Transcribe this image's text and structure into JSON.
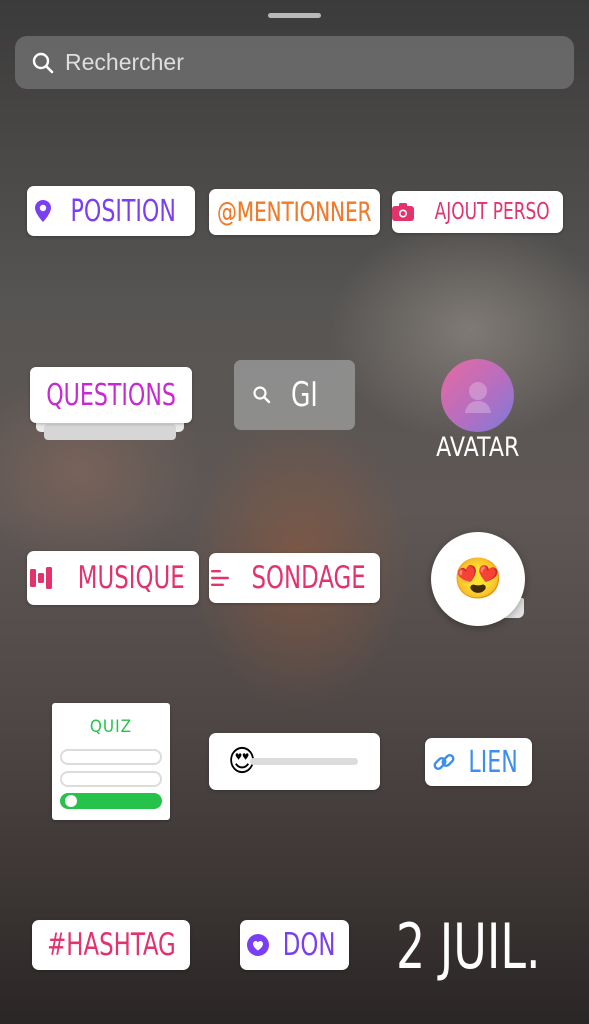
{
  "search": {
    "placeholder": "Rechercher",
    "icon": "search-icon"
  },
  "stickers": {
    "position": "POSITION",
    "mention": "@MENTIONNER",
    "ajout_perso": "AJOUT PERSO",
    "questions": "QUESTIONS",
    "gif": "GI",
    "avatar": "AVATAR",
    "musique": "MUSIQUE",
    "sondage": "SONDAGE",
    "emoji": "😍",
    "quiz": "QUIZ",
    "slider_emoji": "😍",
    "lien": "LIEN",
    "hashtag": "#HASHTAG",
    "don": "DON",
    "date": "2 JUIL."
  },
  "colors": {
    "purple": "#7a3ff2",
    "orange": "#ef7b2c",
    "pink": "#e2336c",
    "magenta": "#c82ad2",
    "blue": "#3d8ef0",
    "green": "#27c24a"
  }
}
